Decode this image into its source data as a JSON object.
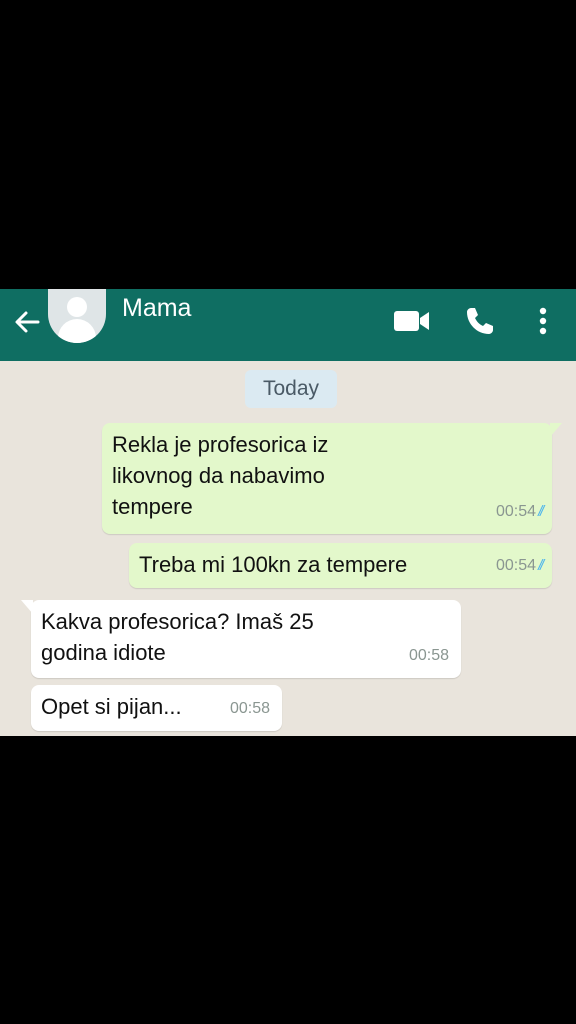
{
  "header": {
    "contact_name": "Mama",
    "back_icon": "arrow-left-icon",
    "video_icon": "video-camera-icon",
    "call_icon": "phone-icon",
    "menu_icon": "more-vertical-icon",
    "background_color": "#0f6e62"
  },
  "chat": {
    "date_label": "Today",
    "messages": [
      {
        "direction": "outgoing",
        "text": "Rekla je profesorica iz\nlikovnog da nabavimo\ntempere",
        "time": "00:54",
        "status": "read"
      },
      {
        "direction": "outgoing",
        "text": "Treba mi 100kn za tempere",
        "time": "00:54",
        "status": "read"
      },
      {
        "direction": "incoming",
        "text": "Kakva profesorica? Imaš 25\ngodina idiote",
        "time": "00:58"
      },
      {
        "direction": "incoming",
        "text": "Opet si pijan...",
        "time": "00:58"
      }
    ],
    "colors": {
      "outgoing_bubble": "#e3f8cb",
      "incoming_bubble": "#ffffff",
      "read_ticks": "#4fb6ec"
    }
  }
}
